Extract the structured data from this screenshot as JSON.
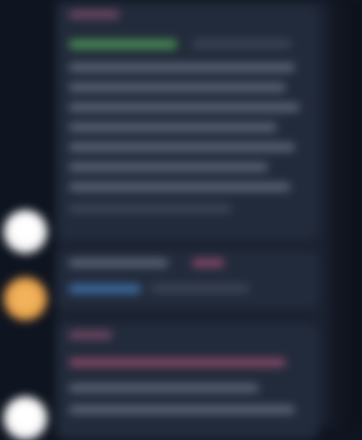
{
  "feed": {
    "messages": [
      {
        "author_placeholder": "",
        "body_placeholder": ""
      },
      {
        "author_placeholder": "",
        "body_placeholder": ""
      },
      {
        "author_placeholder": "",
        "body_placeholder": ""
      }
    ]
  },
  "colors": {
    "background": "#0f1520",
    "feed_panel": "#1a2130",
    "card": "#222b3b",
    "text_line": "#5d6677",
    "name_accent": "#7b4b68",
    "green_accent": "#4a8f54",
    "blue_accent": "#3d6da3",
    "avatar_white": "#f1f1f2",
    "avatar_orange": "#e29a46"
  },
  "icons": {
    "avatar_1": "user-avatar-icon",
    "avatar_2": "user-avatar-icon",
    "avatar_3": "user-avatar-icon"
  }
}
